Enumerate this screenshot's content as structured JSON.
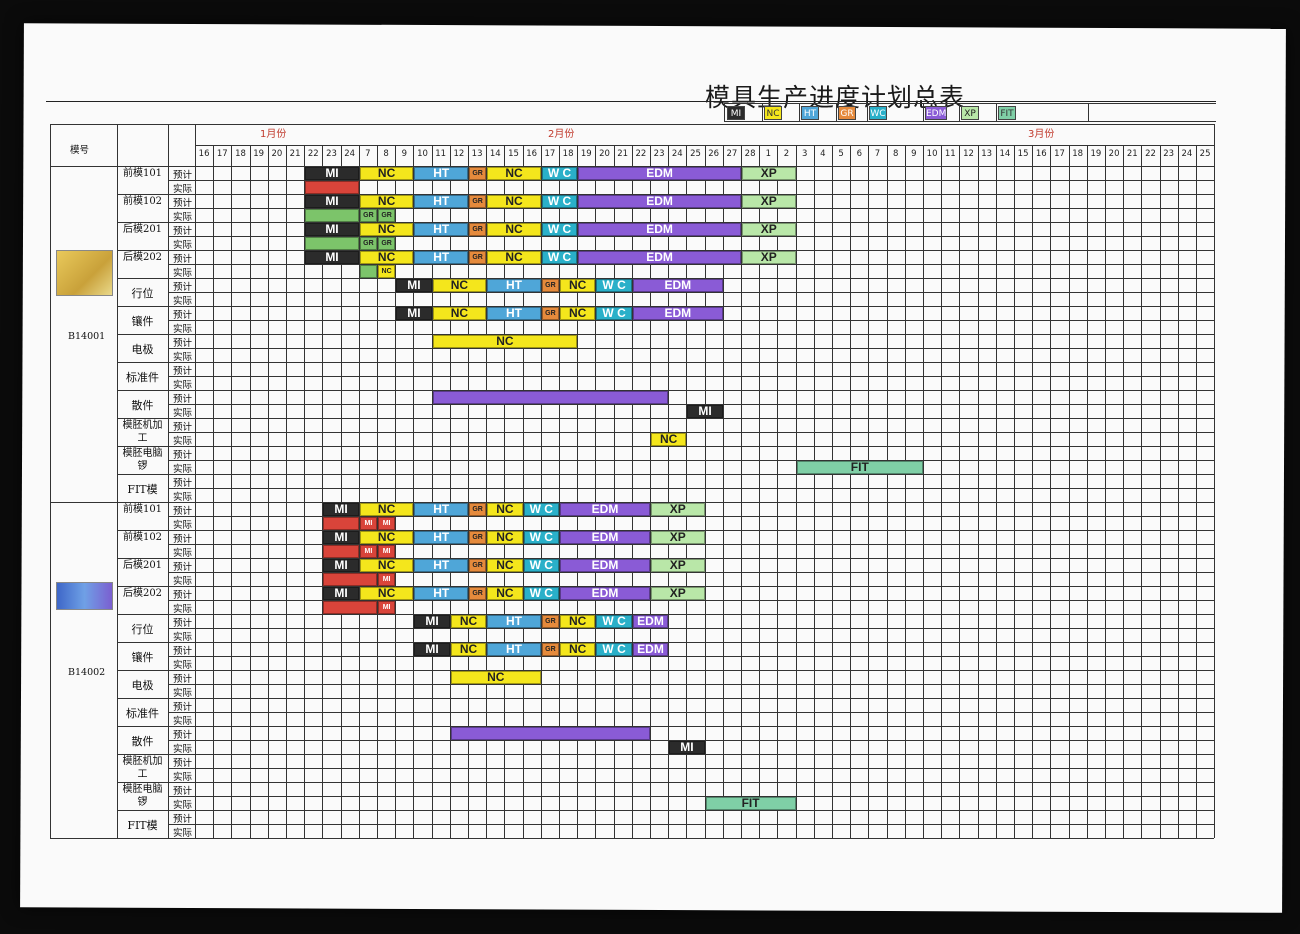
{
  "title": "模具生产进度计划总表",
  "legend": [
    {
      "code": "MI",
      "bg": "#2b2b2b",
      "fg": "#ffffff"
    },
    {
      "code": "NC",
      "bg": "#f4e61c",
      "fg": "#333333"
    },
    {
      "code": "HT",
      "bg": "#4fa6d8",
      "fg": "#ffffff"
    },
    {
      "code": "GR",
      "bg": "#e58a3c",
      "fg": "#ffffff"
    },
    {
      "code": "WC",
      "bg": "#2ab0c9",
      "fg": "#ffffff"
    },
    {
      "code": "EDM",
      "bg": "#8a5bd6",
      "fg": "#ffffff"
    },
    {
      "code": "XP",
      "bg": "#b9e7a8",
      "fg": "#222222"
    },
    {
      "code": "FIT",
      "bg": "#7fcfa6",
      "fg": "#333333"
    }
  ],
  "header": {
    "mold_col": "模号",
    "months": [
      "1月份",
      "2月份",
      "3月份"
    ],
    "days": [
      "16",
      "17",
      "18",
      "19",
      "20",
      "21",
      "22",
      "23",
      "24",
      "7",
      "8",
      "9",
      "10",
      "11",
      "12",
      "13",
      "14",
      "15",
      "16",
      "17",
      "18",
      "19",
      "20",
      "21",
      "22",
      "23",
      "24",
      "25",
      "26",
      "27",
      "28",
      "1",
      "2",
      "3",
      "4",
      "5",
      "6",
      "7",
      "8",
      "9",
      "10",
      "11",
      "12",
      "13",
      "14",
      "15",
      "16",
      "17",
      "18",
      "19",
      "20",
      "21",
      "22",
      "23",
      "24",
      "25"
    ]
  },
  "plan_label": "预计",
  "actual_label": "实际",
  "parts": [
    "前模101",
    "前模102",
    "后模201",
    "后模202",
    "行位",
    "镶件",
    "电极",
    "标准件",
    "散件",
    "模胚机加工",
    "模胚电脑锣",
    "FIT模"
  ],
  "molds": [
    {
      "id": "B14001"
    },
    {
      "id": "B14002"
    }
  ],
  "bars": [
    {
      "m": 0,
      "r": 0,
      "s": 6,
      "e": 9,
      "t": "MI",
      "k": "MI"
    },
    {
      "m": 0,
      "r": 0,
      "s": 9,
      "e": 12,
      "t": "NC",
      "k": "NC"
    },
    {
      "m": 0,
      "r": 0,
      "s": 12,
      "e": 15,
      "t": "HT",
      "k": "HT"
    },
    {
      "m": 0,
      "r": 0,
      "s": 15,
      "e": 16,
      "t": "GR",
      "k": "GR"
    },
    {
      "m": 0,
      "r": 0,
      "s": 16,
      "e": 19,
      "t": "NC",
      "k": "NC"
    },
    {
      "m": 0,
      "r": 0,
      "s": 19,
      "e": 21,
      "t": "W C",
      "k": "WC"
    },
    {
      "m": 0,
      "r": 0,
      "s": 21,
      "e": 30,
      "t": "EDM",
      "k": "EDM"
    },
    {
      "m": 0,
      "r": 0,
      "s": 30,
      "e": 33,
      "t": "XP",
      "k": "XP"
    },
    {
      "m": 0,
      "r": 1,
      "s": 6,
      "e": 9,
      "t": "",
      "k": "RED"
    },
    {
      "m": 0,
      "r": 2,
      "s": 6,
      "e": 9,
      "t": "MI",
      "k": "MI"
    },
    {
      "m": 0,
      "r": 2,
      "s": 9,
      "e": 12,
      "t": "NC",
      "k": "NC"
    },
    {
      "m": 0,
      "r": 2,
      "s": 12,
      "e": 15,
      "t": "HT",
      "k": "HT"
    },
    {
      "m": 0,
      "r": 2,
      "s": 15,
      "e": 16,
      "t": "GR",
      "k": "GR"
    },
    {
      "m": 0,
      "r": 2,
      "s": 16,
      "e": 19,
      "t": "NC",
      "k": "NC"
    },
    {
      "m": 0,
      "r": 2,
      "s": 19,
      "e": 21,
      "t": "W C",
      "k": "WC"
    },
    {
      "m": 0,
      "r": 2,
      "s": 21,
      "e": 30,
      "t": "EDM",
      "k": "EDM"
    },
    {
      "m": 0,
      "r": 2,
      "s": 30,
      "e": 33,
      "t": "XP",
      "k": "XP"
    },
    {
      "m": 0,
      "r": 3,
      "s": 6,
      "e": 9,
      "t": "",
      "k": "GREEN"
    },
    {
      "m": 0,
      "r": 3,
      "s": 9,
      "e": 10,
      "t": "GR",
      "k": "GREEN"
    },
    {
      "m": 0,
      "r": 3,
      "s": 10,
      "e": 11,
      "t": "GR",
      "k": "GREEN"
    },
    {
      "m": 0,
      "r": 4,
      "s": 6,
      "e": 9,
      "t": "MI",
      "k": "MI"
    },
    {
      "m": 0,
      "r": 4,
      "s": 9,
      "e": 12,
      "t": "NC",
      "k": "NC"
    },
    {
      "m": 0,
      "r": 4,
      "s": 12,
      "e": 15,
      "t": "HT",
      "k": "HT"
    },
    {
      "m": 0,
      "r": 4,
      "s": 15,
      "e": 16,
      "t": "GR",
      "k": "GR"
    },
    {
      "m": 0,
      "r": 4,
      "s": 16,
      "e": 19,
      "t": "NC",
      "k": "NC"
    },
    {
      "m": 0,
      "r": 4,
      "s": 19,
      "e": 21,
      "t": "W C",
      "k": "WC"
    },
    {
      "m": 0,
      "r": 4,
      "s": 21,
      "e": 30,
      "t": "EDM",
      "k": "EDM"
    },
    {
      "m": 0,
      "r": 4,
      "s": 30,
      "e": 33,
      "t": "XP",
      "k": "XP"
    },
    {
      "m": 0,
      "r": 5,
      "s": 6,
      "e": 9,
      "t": "",
      "k": "GREEN"
    },
    {
      "m": 0,
      "r": 5,
      "s": 9,
      "e": 10,
      "t": "GR",
      "k": "GREEN"
    },
    {
      "m": 0,
      "r": 5,
      "s": 10,
      "e": 11,
      "t": "GR",
      "k": "GREEN"
    },
    {
      "m": 0,
      "r": 6,
      "s": 6,
      "e": 9,
      "t": "MI",
      "k": "MI"
    },
    {
      "m": 0,
      "r": 6,
      "s": 9,
      "e": 12,
      "t": "NC",
      "k": "NC"
    },
    {
      "m": 0,
      "r": 6,
      "s": 12,
      "e": 15,
      "t": "HT",
      "k": "HT"
    },
    {
      "m": 0,
      "r": 6,
      "s": 15,
      "e": 16,
      "t": "GR",
      "k": "GR"
    },
    {
      "m": 0,
      "r": 6,
      "s": 16,
      "e": 19,
      "t": "NC",
      "k": "NC"
    },
    {
      "m": 0,
      "r": 6,
      "s": 19,
      "e": 21,
      "t": "W C",
      "k": "WC"
    },
    {
      "m": 0,
      "r": 6,
      "s": 21,
      "e": 30,
      "t": "EDM",
      "k": "EDM"
    },
    {
      "m": 0,
      "r": 6,
      "s": 30,
      "e": 33,
      "t": "XP",
      "k": "XP"
    },
    {
      "m": 0,
      "r": 7,
      "s": 9,
      "e": 10,
      "t": "",
      "k": "GREEN"
    },
    {
      "m": 0,
      "r": 7,
      "s": 10,
      "e": 11,
      "t": "NC",
      "k": "NC"
    },
    {
      "m": 0,
      "r": 8,
      "s": 11,
      "e": 13,
      "t": "MI",
      "k": "MI"
    },
    {
      "m": 0,
      "r": 8,
      "s": 13,
      "e": 16,
      "t": "NC",
      "k": "NC"
    },
    {
      "m": 0,
      "r": 8,
      "s": 16,
      "e": 19,
      "t": "HT",
      "k": "HT"
    },
    {
      "m": 0,
      "r": 8,
      "s": 19,
      "e": 20,
      "t": "GR",
      "k": "GR"
    },
    {
      "m": 0,
      "r": 8,
      "s": 20,
      "e": 22,
      "t": "NC",
      "k": "NC"
    },
    {
      "m": 0,
      "r": 8,
      "s": 22,
      "e": 24,
      "t": "W C",
      "k": "WC"
    },
    {
      "m": 0,
      "r": 8,
      "s": 24,
      "e": 29,
      "t": "EDM",
      "k": "EDM"
    },
    {
      "m": 0,
      "r": 10,
      "s": 11,
      "e": 13,
      "t": "MI",
      "k": "MI"
    },
    {
      "m": 0,
      "r": 10,
      "s": 13,
      "e": 16,
      "t": "NC",
      "k": "NC"
    },
    {
      "m": 0,
      "r": 10,
      "s": 16,
      "e": 19,
      "t": "HT",
      "k": "HT"
    },
    {
      "m": 0,
      "r": 10,
      "s": 19,
      "e": 20,
      "t": "GR",
      "k": "GR"
    },
    {
      "m": 0,
      "r": 10,
      "s": 20,
      "e": 22,
      "t": "NC",
      "k": "NC"
    },
    {
      "m": 0,
      "r": 10,
      "s": 22,
      "e": 24,
      "t": "W C",
      "k": "WC"
    },
    {
      "m": 0,
      "r": 10,
      "s": 24,
      "e": 29,
      "t": "EDM",
      "k": "EDM"
    },
    {
      "m": 0,
      "r": 12,
      "s": 13,
      "e": 21,
      "t": "NC",
      "k": "NC"
    },
    {
      "m": 0,
      "r": 16,
      "s": 13,
      "e": 26,
      "t": "",
      "k": "EDM"
    },
    {
      "m": 0,
      "r": 17,
      "s": 27,
      "e": 29,
      "t": "MI",
      "k": "MI"
    },
    {
      "m": 0,
      "r": 19,
      "s": 25,
      "e": 27,
      "t": "NC",
      "k": "NC"
    },
    {
      "m": 0,
      "r": 21,
      "s": 33,
      "e": 40,
      "t": "FIT",
      "k": "FIT"
    },
    {
      "m": 1,
      "r": 0,
      "s": 7,
      "e": 9,
      "t": "MI",
      "k": "MI"
    },
    {
      "m": 1,
      "r": 0,
      "s": 9,
      "e": 12,
      "t": "NC",
      "k": "NC"
    },
    {
      "m": 1,
      "r": 0,
      "s": 12,
      "e": 15,
      "t": "HT",
      "k": "HT"
    },
    {
      "m": 1,
      "r": 0,
      "s": 15,
      "e": 16,
      "t": "GR",
      "k": "GR"
    },
    {
      "m": 1,
      "r": 0,
      "s": 16,
      "e": 18,
      "t": "NC",
      "k": "NC"
    },
    {
      "m": 1,
      "r": 0,
      "s": 18,
      "e": 20,
      "t": "W C",
      "k": "WC"
    },
    {
      "m": 1,
      "r": 0,
      "s": 20,
      "e": 25,
      "t": "EDM",
      "k": "EDM"
    },
    {
      "m": 1,
      "r": 0,
      "s": 25,
      "e": 28,
      "t": "XP",
      "k": "XP"
    },
    {
      "m": 1,
      "r": 1,
      "s": 7,
      "e": 9,
      "t": "",
      "k": "RED"
    },
    {
      "m": 1,
      "r": 1,
      "s": 9,
      "e": 10,
      "t": "MI",
      "k": "RED"
    },
    {
      "m": 1,
      "r": 1,
      "s": 10,
      "e": 11,
      "t": "MI",
      "k": "RED"
    },
    {
      "m": 1,
      "r": 2,
      "s": 7,
      "e": 9,
      "t": "MI",
      "k": "MI"
    },
    {
      "m": 1,
      "r": 2,
      "s": 9,
      "e": 12,
      "t": "NC",
      "k": "NC"
    },
    {
      "m": 1,
      "r": 2,
      "s": 12,
      "e": 15,
      "t": "HT",
      "k": "HT"
    },
    {
      "m": 1,
      "r": 2,
      "s": 15,
      "e": 16,
      "t": "GR",
      "k": "GR"
    },
    {
      "m": 1,
      "r": 2,
      "s": 16,
      "e": 18,
      "t": "NC",
      "k": "NC"
    },
    {
      "m": 1,
      "r": 2,
      "s": 18,
      "e": 20,
      "t": "W C",
      "k": "WC"
    },
    {
      "m": 1,
      "r": 2,
      "s": 20,
      "e": 25,
      "t": "EDM",
      "k": "EDM"
    },
    {
      "m": 1,
      "r": 2,
      "s": 25,
      "e": 28,
      "t": "XP",
      "k": "XP"
    },
    {
      "m": 1,
      "r": 3,
      "s": 7,
      "e": 9,
      "t": "",
      "k": "RED"
    },
    {
      "m": 1,
      "r": 3,
      "s": 9,
      "e": 10,
      "t": "MI",
      "k": "RED"
    },
    {
      "m": 1,
      "r": 3,
      "s": 10,
      "e": 11,
      "t": "MI",
      "k": "RED"
    },
    {
      "m": 1,
      "r": 4,
      "s": 7,
      "e": 9,
      "t": "MI",
      "k": "MI"
    },
    {
      "m": 1,
      "r": 4,
      "s": 9,
      "e": 12,
      "t": "NC",
      "k": "NC"
    },
    {
      "m": 1,
      "r": 4,
      "s": 12,
      "e": 15,
      "t": "HT",
      "k": "HT"
    },
    {
      "m": 1,
      "r": 4,
      "s": 15,
      "e": 16,
      "t": "GR",
      "k": "GR"
    },
    {
      "m": 1,
      "r": 4,
      "s": 16,
      "e": 18,
      "t": "NC",
      "k": "NC"
    },
    {
      "m": 1,
      "r": 4,
      "s": 18,
      "e": 20,
      "t": "W C",
      "k": "WC"
    },
    {
      "m": 1,
      "r": 4,
      "s": 20,
      "e": 25,
      "t": "EDM",
      "k": "EDM"
    },
    {
      "m": 1,
      "r": 4,
      "s": 25,
      "e": 28,
      "t": "XP",
      "k": "XP"
    },
    {
      "m": 1,
      "r": 5,
      "s": 7,
      "e": 10,
      "t": "",
      "k": "RED"
    },
    {
      "m": 1,
      "r": 5,
      "s": 10,
      "e": 11,
      "t": "MI",
      "k": "RED"
    },
    {
      "m": 1,
      "r": 6,
      "s": 7,
      "e": 9,
      "t": "MI",
      "k": "MI"
    },
    {
      "m": 1,
      "r": 6,
      "s": 9,
      "e": 12,
      "t": "NC",
      "k": "NC"
    },
    {
      "m": 1,
      "r": 6,
      "s": 12,
      "e": 15,
      "t": "HT",
      "k": "HT"
    },
    {
      "m": 1,
      "r": 6,
      "s": 15,
      "e": 16,
      "t": "GR",
      "k": "GR"
    },
    {
      "m": 1,
      "r": 6,
      "s": 16,
      "e": 18,
      "t": "NC",
      "k": "NC"
    },
    {
      "m": 1,
      "r": 6,
      "s": 18,
      "e": 20,
      "t": "W C",
      "k": "WC"
    },
    {
      "m": 1,
      "r": 6,
      "s": 20,
      "e": 25,
      "t": "EDM",
      "k": "EDM"
    },
    {
      "m": 1,
      "r": 6,
      "s": 25,
      "e": 28,
      "t": "XP",
      "k": "XP"
    },
    {
      "m": 1,
      "r": 7,
      "s": 7,
      "e": 10,
      "t": "",
      "k": "RED"
    },
    {
      "m": 1,
      "r": 7,
      "s": 10,
      "e": 11,
      "t": "MI",
      "k": "RED"
    },
    {
      "m": 1,
      "r": 8,
      "s": 12,
      "e": 14,
      "t": "MI",
      "k": "MI"
    },
    {
      "m": 1,
      "r": 8,
      "s": 14,
      "e": 16,
      "t": "NC",
      "k": "NC"
    },
    {
      "m": 1,
      "r": 8,
      "s": 16,
      "e": 19,
      "t": "HT",
      "k": "HT"
    },
    {
      "m": 1,
      "r": 8,
      "s": 19,
      "e": 20,
      "t": "GR",
      "k": "GR"
    },
    {
      "m": 1,
      "r": 8,
      "s": 20,
      "e": 22,
      "t": "NC",
      "k": "NC"
    },
    {
      "m": 1,
      "r": 8,
      "s": 22,
      "e": 24,
      "t": "W C",
      "k": "WC"
    },
    {
      "m": 1,
      "r": 8,
      "s": 24,
      "e": 26,
      "t": "EDM",
      "k": "EDM"
    },
    {
      "m": 1,
      "r": 10,
      "s": 12,
      "e": 14,
      "t": "MI",
      "k": "MI"
    },
    {
      "m": 1,
      "r": 10,
      "s": 14,
      "e": 16,
      "t": "NC",
      "k": "NC"
    },
    {
      "m": 1,
      "r": 10,
      "s": 16,
      "e": 19,
      "t": "HT",
      "k": "HT"
    },
    {
      "m": 1,
      "r": 10,
      "s": 19,
      "e": 20,
      "t": "GR",
      "k": "GR"
    },
    {
      "m": 1,
      "r": 10,
      "s": 20,
      "e": 22,
      "t": "NC",
      "k": "NC"
    },
    {
      "m": 1,
      "r": 10,
      "s": 22,
      "e": 24,
      "t": "W C",
      "k": "WC"
    },
    {
      "m": 1,
      "r": 10,
      "s": 24,
      "e": 26,
      "t": "EDM",
      "k": "EDM"
    },
    {
      "m": 1,
      "r": 12,
      "s": 14,
      "e": 19,
      "t": "NC",
      "k": "NC"
    },
    {
      "m": 1,
      "r": 16,
      "s": 14,
      "e": 25,
      "t": "",
      "k": "EDM"
    },
    {
      "m": 1,
      "r": 17,
      "s": 26,
      "e": 28,
      "t": "MI",
      "k": "MI"
    },
    {
      "m": 1,
      "r": 21,
      "s": 28,
      "e": 33,
      "t": "FIT",
      "k": "FIT"
    }
  ],
  "colors": {
    "MI": "#2b2b2b",
    "NC": "#f4e61c",
    "HT": "#4fa6d8",
    "GR": "#e58a3c",
    "WC": "#2ab0c9",
    "EDM": "#8a5bd6",
    "XP": "#b9e7a8",
    "FIT": "#7fcfa6",
    "RED": "#d9443a",
    "GREEN": "#7cc46a"
  }
}
